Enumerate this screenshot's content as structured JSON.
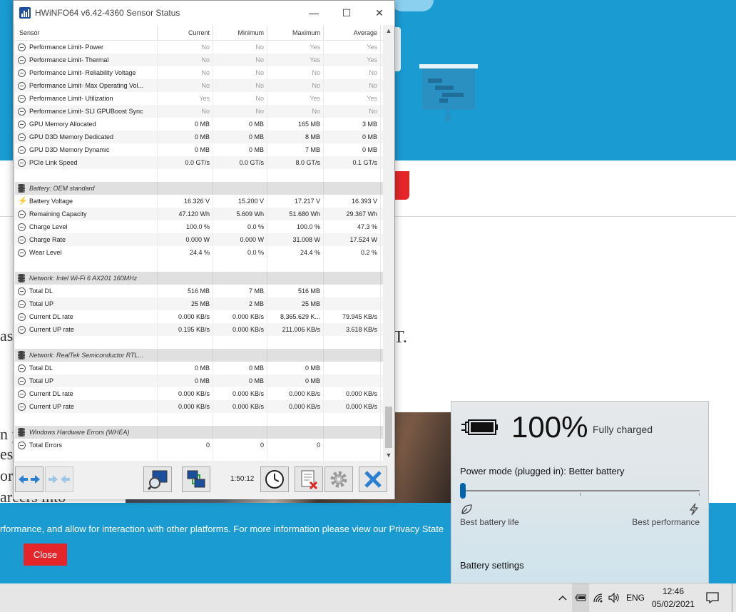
{
  "window": {
    "title": "HWiNFO64 v6.42-4360 Sensor Status",
    "minimize_glyph": "—",
    "maximize_glyph": "☐",
    "close_glyph": "✕"
  },
  "columns": {
    "sensor": "Sensor",
    "current": "Current",
    "minimum": "Minimum",
    "maximum": "Maximum",
    "average": "Average"
  },
  "gpu_rows": [
    {
      "name": "Performance Limit- Power",
      "current": "No",
      "min": "No",
      "max": "Yes",
      "avg": "Yes",
      "dim": true
    },
    {
      "name": "Performance Limit- Thermal",
      "current": "No",
      "min": "No",
      "max": "Yes",
      "avg": "Yes",
      "dim": true
    },
    {
      "name": "Performance Limit- Reliability Voltage",
      "current": "No",
      "min": "No",
      "max": "No",
      "avg": "No",
      "dim": true
    },
    {
      "name": "Performance Limit- Max Operating Vol...",
      "current": "No",
      "min": "No",
      "max": "No",
      "avg": "No",
      "dim": true
    },
    {
      "name": "Performance Limit- Utilization",
      "current": "Yes",
      "min": "No",
      "max": "Yes",
      "avg": "Yes",
      "dim": true
    },
    {
      "name": "Performance Limit- SLI GPUBoost Sync",
      "current": "No",
      "min": "No",
      "max": "No",
      "avg": "No",
      "dim": true
    },
    {
      "name": "GPU Memory Allocated",
      "current": "0 MB",
      "min": "0 MB",
      "max": "165 MB",
      "avg": "3 MB"
    },
    {
      "name": "GPU D3D Memory Dedicated",
      "current": "0 MB",
      "min": "0 MB",
      "max": "8 MB",
      "avg": "0 MB"
    },
    {
      "name": "GPU D3D Memory Dynamic",
      "current": "0 MB",
      "min": "0 MB",
      "max": "7 MB",
      "avg": "0 MB"
    },
    {
      "name": "PCIe Link Speed",
      "current": "0.0 GT/s",
      "min": "0.0 GT/s",
      "max": "8.0 GT/s",
      "avg": "0.1 GT/s"
    }
  ],
  "battery_group": "Battery: OEM standard",
  "battery_rows": [
    {
      "name": "Battery Voltage",
      "current": "16.326 V",
      "min": "15.200 V",
      "max": "17.217 V",
      "avg": "16.393 V",
      "icon": "bolt"
    },
    {
      "name": "Remaining Capacity",
      "current": "47.120 Wh",
      "min": "5.609 Wh",
      "max": "51.680 Wh",
      "avg": "29.367 Wh"
    },
    {
      "name": "Charge Level",
      "current": "100.0 %",
      "min": "0.0 %",
      "max": "100.0 %",
      "avg": "47.3 %"
    },
    {
      "name": "Charge Rate",
      "current": "0.000 W",
      "min": "0.000 W",
      "max": "31.008 W",
      "avg": "17.524 W"
    },
    {
      "name": "Wear Level",
      "current": "24.4 %",
      "min": "0.0 %",
      "max": "24.4 %",
      "avg": "0.2 %"
    }
  ],
  "wifi_group": "Network: Intel Wi-Fi 6 AX201 160MHz",
  "wifi_rows": [
    {
      "name": "Total DL",
      "current": "516 MB",
      "min": "7 MB",
      "max": "516 MB",
      "avg": ""
    },
    {
      "name": "Total UP",
      "current": "25 MB",
      "min": "2 MB",
      "max": "25 MB",
      "avg": ""
    },
    {
      "name": "Current DL rate",
      "current": "0.000 KB/s",
      "min": "0.000 KB/s",
      "max": "8,365.629 K...",
      "avg": "79.945 KB/s"
    },
    {
      "name": "Current UP rate",
      "current": "0.195 KB/s",
      "min": "0.000 KB/s",
      "max": "211.006 KB/s",
      "avg": "3.618 KB/s"
    }
  ],
  "realtek_group": "Network: RealTek Semiconductor RTL...",
  "realtek_rows": [
    {
      "name": "Total DL",
      "current": "0 MB",
      "min": "0 MB",
      "max": "0 MB",
      "avg": ""
    },
    {
      "name": "Total UP",
      "current": "0 MB",
      "min": "0 MB",
      "max": "0 MB",
      "avg": ""
    },
    {
      "name": "Current DL rate",
      "current": "0.000 KB/s",
      "min": "0.000 KB/s",
      "max": "0.000 KB/s",
      "avg": "0.000 KB/s"
    },
    {
      "name": "Current UP rate",
      "current": "0.000 KB/s",
      "min": "0.000 KB/s",
      "max": "0.000 KB/s",
      "avg": "0.000 KB/s"
    }
  ],
  "whea_group": "Windows Hardware Errors (WHEA)",
  "whea_rows": [
    {
      "name": "Total Errors",
      "current": "0",
      "min": "0",
      "max": "0",
      "avg": ""
    }
  ],
  "toolbar": {
    "elapsed": "1:50:12"
  },
  "background": {
    "banner_text": "rformance, and allow for interaction with other platforms. For more information please view our Privacy State",
    "close_label": "Close",
    "fragment_t": "T.",
    "fragment_left": [
      "as",
      "n p",
      "es",
      "or",
      "areers into"
    ]
  },
  "battery_flyout": {
    "percent": "100%",
    "status": "Fully charged",
    "power_mode": "Power mode (plugged in): Better battery",
    "slider_value": 0,
    "label_left": "Best battery life",
    "label_right": "Best performance",
    "settings_link": "Battery settings"
  },
  "taskbar": {
    "language": "ENG",
    "time": "12:46",
    "date": "05/02/2021"
  },
  "colors": {
    "accent_blue": "#1a9bd2",
    "close_red": "#e4262b",
    "slider_thumb": "#0063b1"
  }
}
